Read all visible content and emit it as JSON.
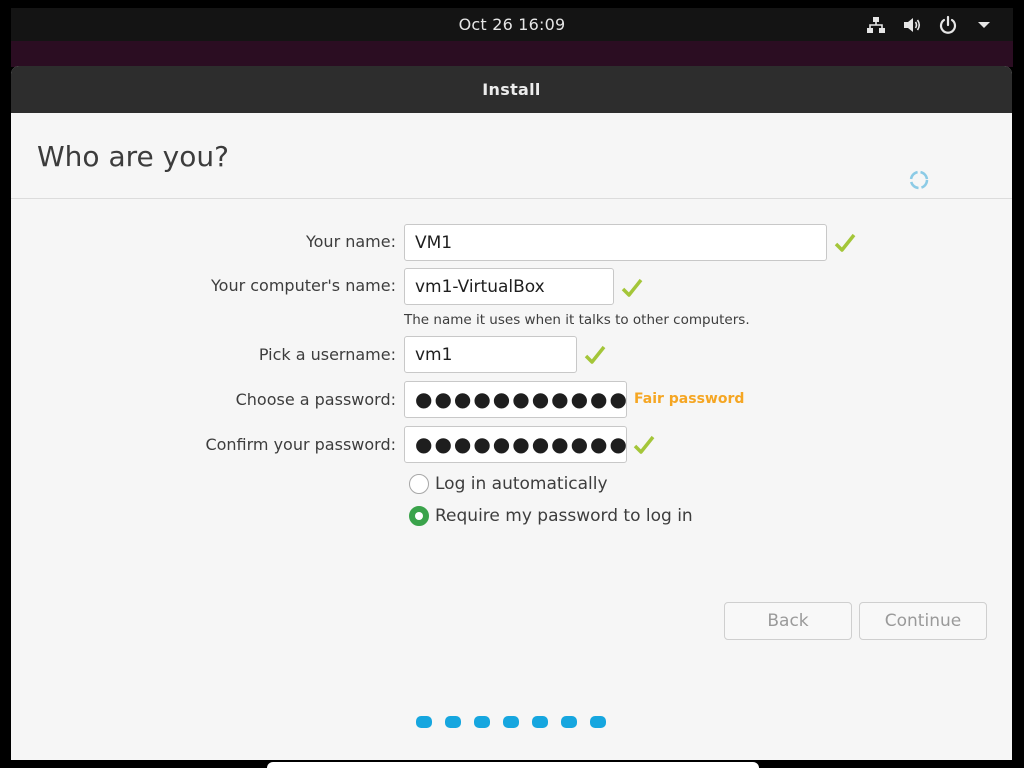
{
  "topbar": {
    "clock": "Oct 26  16:09",
    "icons": [
      "network-icon",
      "volume-icon",
      "power-icon",
      "menu-chevron-icon"
    ]
  },
  "window": {
    "title": "Install"
  },
  "page": {
    "heading": "Who are you?"
  },
  "form": {
    "name_label": "Your name:",
    "name_value": "VM1",
    "computer_label": "Your computer's name:",
    "computer_value": "vm1-VirtualBox",
    "computer_hint": "The name it uses when it talks to other computers.",
    "username_label": "Pick a username:",
    "username_value": "vm1",
    "password_label": "Choose a password:",
    "password_value": "●●●●●●●●●●●",
    "password_strength": "Fair password",
    "confirm_label": "Confirm your password:",
    "confirm_value": "●●●●●●●●●●●",
    "login_options": [
      {
        "label": "Log in automatically",
        "selected": false
      },
      {
        "label": "Require my password to log in",
        "selected": true
      }
    ]
  },
  "buttons": {
    "back": "Back",
    "continue": "Continue"
  },
  "progress": {
    "dots_total": 7
  },
  "colors": {
    "check": "#a4c639",
    "strength_fair": "#f5a623",
    "radio_selected": "#3aa34b",
    "progress_dot": "#16a6df"
  }
}
